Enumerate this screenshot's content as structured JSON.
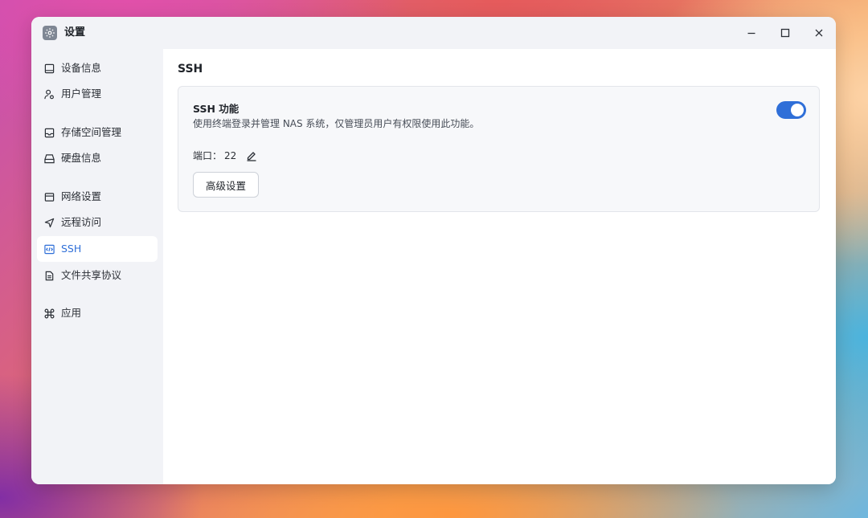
{
  "window": {
    "title": "设置",
    "controls": {
      "minimize": "minimize-icon",
      "maximize": "maximize-icon",
      "close": "close-icon"
    }
  },
  "sidebar": {
    "items": [
      {
        "label": "设备信息",
        "icon": "device-info-icon",
        "active": false
      },
      {
        "label": "用户管理",
        "icon": "user-icon",
        "active": false
      },
      {
        "label": "存储空间管理",
        "icon": "storage-icon",
        "active": false
      },
      {
        "label": "硬盘信息",
        "icon": "hard-disk-icon",
        "active": false
      },
      {
        "label": "网络设置",
        "icon": "network-icon",
        "active": false
      },
      {
        "label": "远程访问",
        "icon": "remote-access-icon",
        "active": false
      },
      {
        "label": "SSH",
        "icon": "code-icon",
        "active": true
      },
      {
        "label": "文件共享协议",
        "icon": "document-icon",
        "active": false
      },
      {
        "label": "应用",
        "icon": "command-icon",
        "active": false
      }
    ]
  },
  "main": {
    "title": "SSH",
    "ssh_card": {
      "feature_title": "SSH 功能",
      "description": "使用终端登录并管理 NAS 系统，仅管理员用户有权限使用此功能。",
      "enabled": true,
      "port_label": "端口：",
      "port_value": "22",
      "advanced_button": "高级设置"
    }
  },
  "colors": {
    "accent": "#2f6fd8",
    "sidebar_bg": "#f2f3f7",
    "card_bg": "#f7f8fa"
  }
}
